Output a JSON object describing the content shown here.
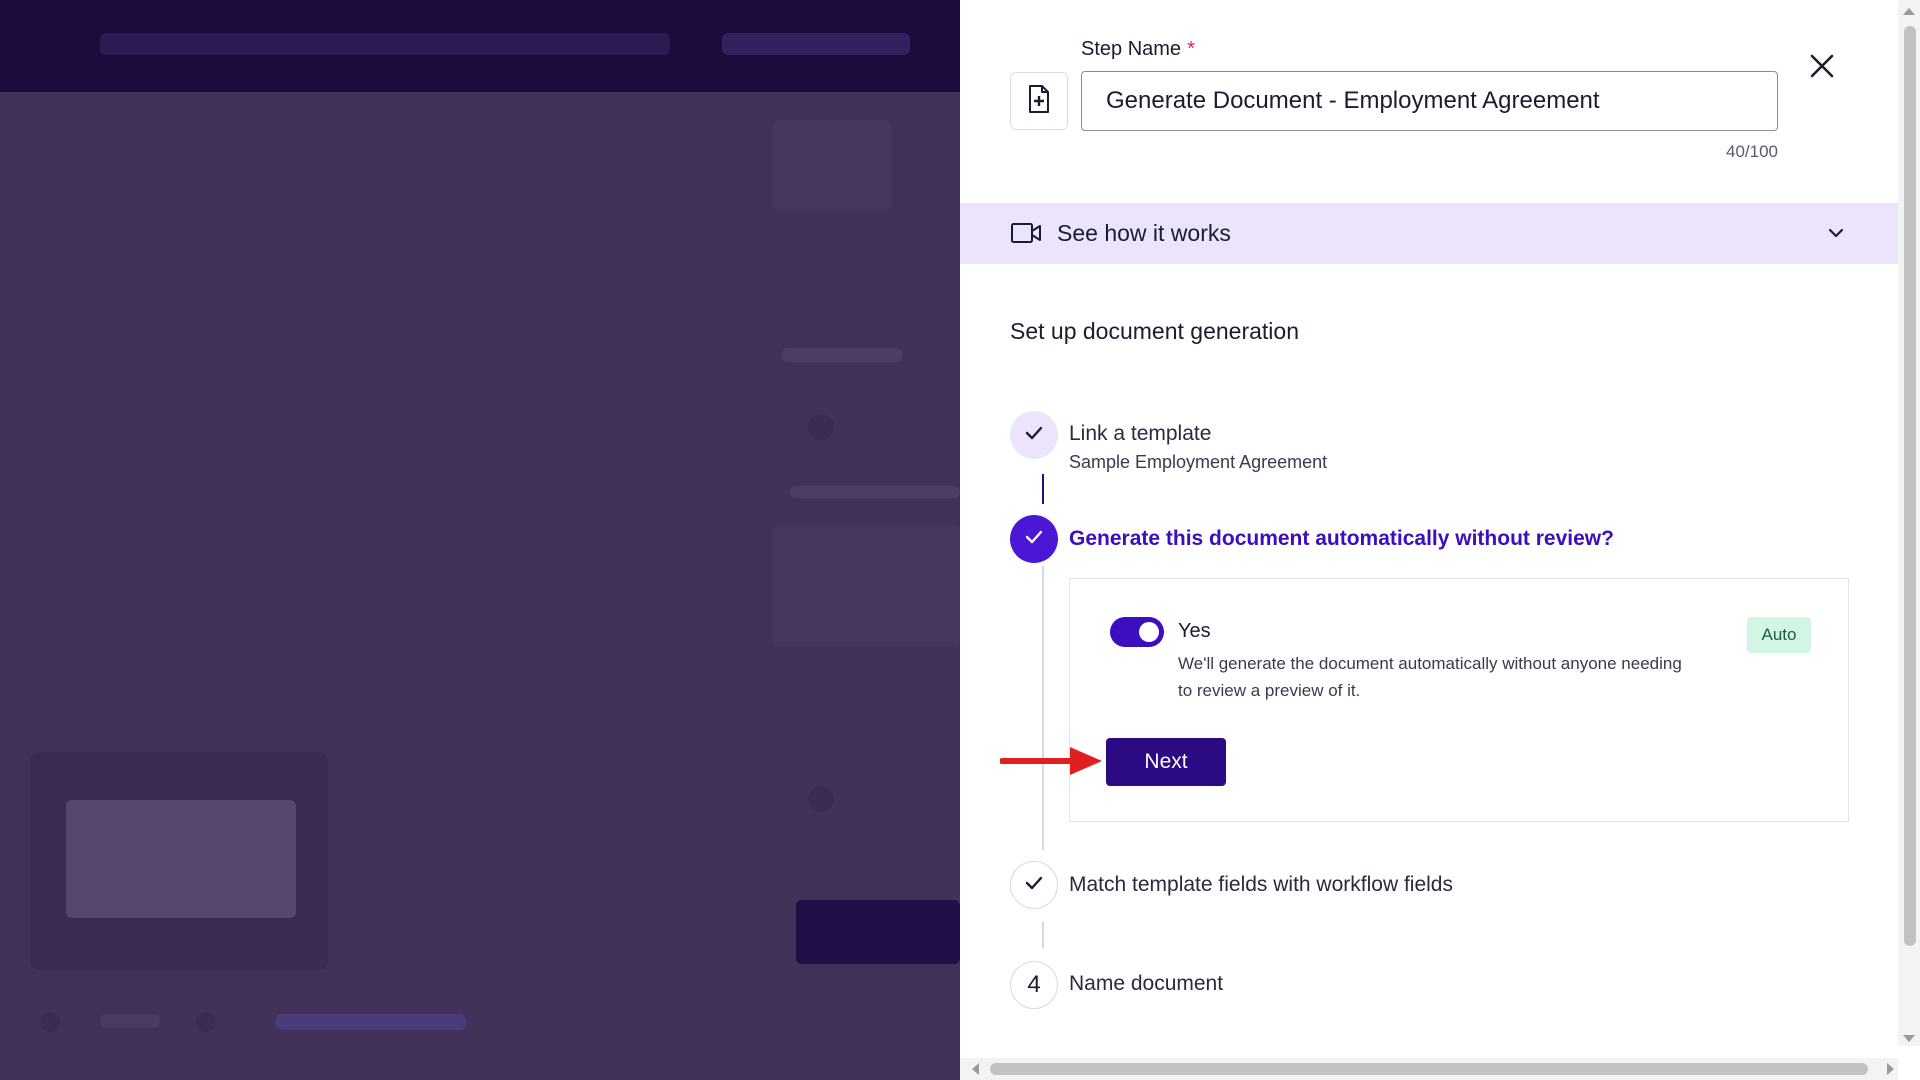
{
  "panel": {
    "step_name_label": "Step Name",
    "required_marker": "*",
    "step_name_value": "Generate Document - Employment Agreement",
    "char_count": "40/100",
    "see_how_label": "See how it works",
    "section_title": "Set up document generation"
  },
  "steps": [
    {
      "title": "Link a template",
      "subtitle": "Sample Employment Agreement",
      "state": "complete"
    },
    {
      "title": "Generate this document automatically without review?",
      "state": "active"
    },
    {
      "title": "Match template fields with workflow fields",
      "state": "complete"
    },
    {
      "title": "Name document",
      "number": "4",
      "state": "pending"
    }
  ],
  "auto_option": {
    "toggle_on": true,
    "label": "Yes",
    "description": "We'll generate the document automatically without anyone needing to review a preview of it.",
    "badge": "Auto",
    "next_label": "Next"
  },
  "colors": {
    "accent": "#4a17d6",
    "button": "#2c0a84",
    "highlight_bg": "#ebe4fb",
    "badge_bg": "#d3f5e6",
    "annotation_arrow": "#e02020",
    "overlay": "#423259"
  },
  "icons": {
    "step_icon": "document-plus-icon",
    "close": "close-icon",
    "video": "video-camera-icon",
    "expand": "chevron-down-icon",
    "check": "check-icon"
  }
}
